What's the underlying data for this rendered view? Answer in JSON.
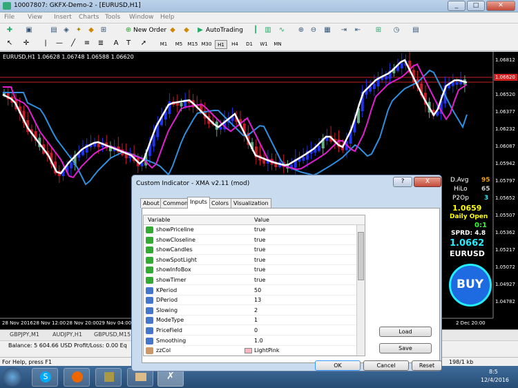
{
  "window": {
    "title": "10007807: GKFX-Demo-2 - [EURUSD,H1]"
  },
  "menu": [
    "File",
    "View",
    "Insert",
    "Charts",
    "Tools",
    "Window",
    "Help"
  ],
  "toolbar": {
    "new_order": "New Order",
    "autotrading": "AutoTrading",
    "timeframes": [
      "M1",
      "M5",
      "M15",
      "M30",
      "H1",
      "H4",
      "D1",
      "W1",
      "MN"
    ]
  },
  "chart": {
    "header": "EURUSD,H1  1.06628 1.06748 1.06588 1.06620",
    "price_labels": [
      "1.06812",
      "1.06620",
      "1.06520",
      "1.06377",
      "1.06232",
      "1.06087",
      "1.05942",
      "1.05797",
      "1.05652",
      "1.05507",
      "1.05362",
      "1.05217",
      "1.05072",
      "1.04927",
      "1.04782"
    ],
    "time_labels": [
      "28 Nov 2016",
      "28 Nov 12:00",
      "28 Nov 20:00",
      "29 Nov 04:00",
      "2 Dec 20:00"
    ],
    "current_price": "1.06620"
  },
  "info_panel": {
    "davg_label": "D.Avg",
    "davg": "95",
    "hilo_label": "HiLo",
    "hilo": "65",
    "p2op_label": "P2Op",
    "p2op": "3",
    "price1": "1.0659",
    "daily_open": "Daily Open",
    "ratio": "0:1",
    "spread": "SPRD: 4.8",
    "price2": "1.0662",
    "symbol": "EURUSD",
    "buy": "BUY"
  },
  "symbol_tabs": [
    "GBPJPY,M1",
    "AUDJPY,H1",
    "GBPUSD,M15"
  ],
  "status": {
    "balance": "Balance: 5 604.66 USD  Profit/Loss: 0.00  Eq",
    "help": "For Help, press F1",
    "connection": "198/1 kb"
  },
  "clock": {
    "time": "8:5",
    "date": "12/4/2016"
  },
  "dialog": {
    "title": "Custom Indicator - XMA v2.11 (mod)",
    "tabs": [
      "About",
      "Common",
      "Inputs",
      "Colors",
      "Visualization"
    ],
    "col_variable": "Variable",
    "col_value": "Value",
    "rows": [
      {
        "name": "showPriceline",
        "value": "true",
        "type": "bool"
      },
      {
        "name": "showCloseline",
        "value": "true",
        "type": "bool"
      },
      {
        "name": "showCandles",
        "value": "true",
        "type": "bool"
      },
      {
        "name": "showSpotLight",
        "value": "true",
        "type": "bool"
      },
      {
        "name": "showInfoBox",
        "value": "true",
        "type": "bool"
      },
      {
        "name": "showTimer",
        "value": "true",
        "type": "bool"
      },
      {
        "name": "KPeriod",
        "value": "50",
        "type": "int"
      },
      {
        "name": "DPeriod",
        "value": "13",
        "type": "int"
      },
      {
        "name": "Slowing",
        "value": "2",
        "type": "int"
      },
      {
        "name": "ModeType",
        "value": "1",
        "type": "int"
      },
      {
        "name": "PriceField",
        "value": "0",
        "type": "int"
      },
      {
        "name": "Smoothing",
        "value": "1.0",
        "type": "dbl"
      },
      {
        "name": "zzCol",
        "value": "LightPink",
        "type": "color"
      }
    ],
    "load": "Load",
    "save": "Save",
    "ok": "OK",
    "cancel": "Cancel",
    "reset": "Reset",
    "help_btn": "?",
    "close_btn": "X"
  }
}
